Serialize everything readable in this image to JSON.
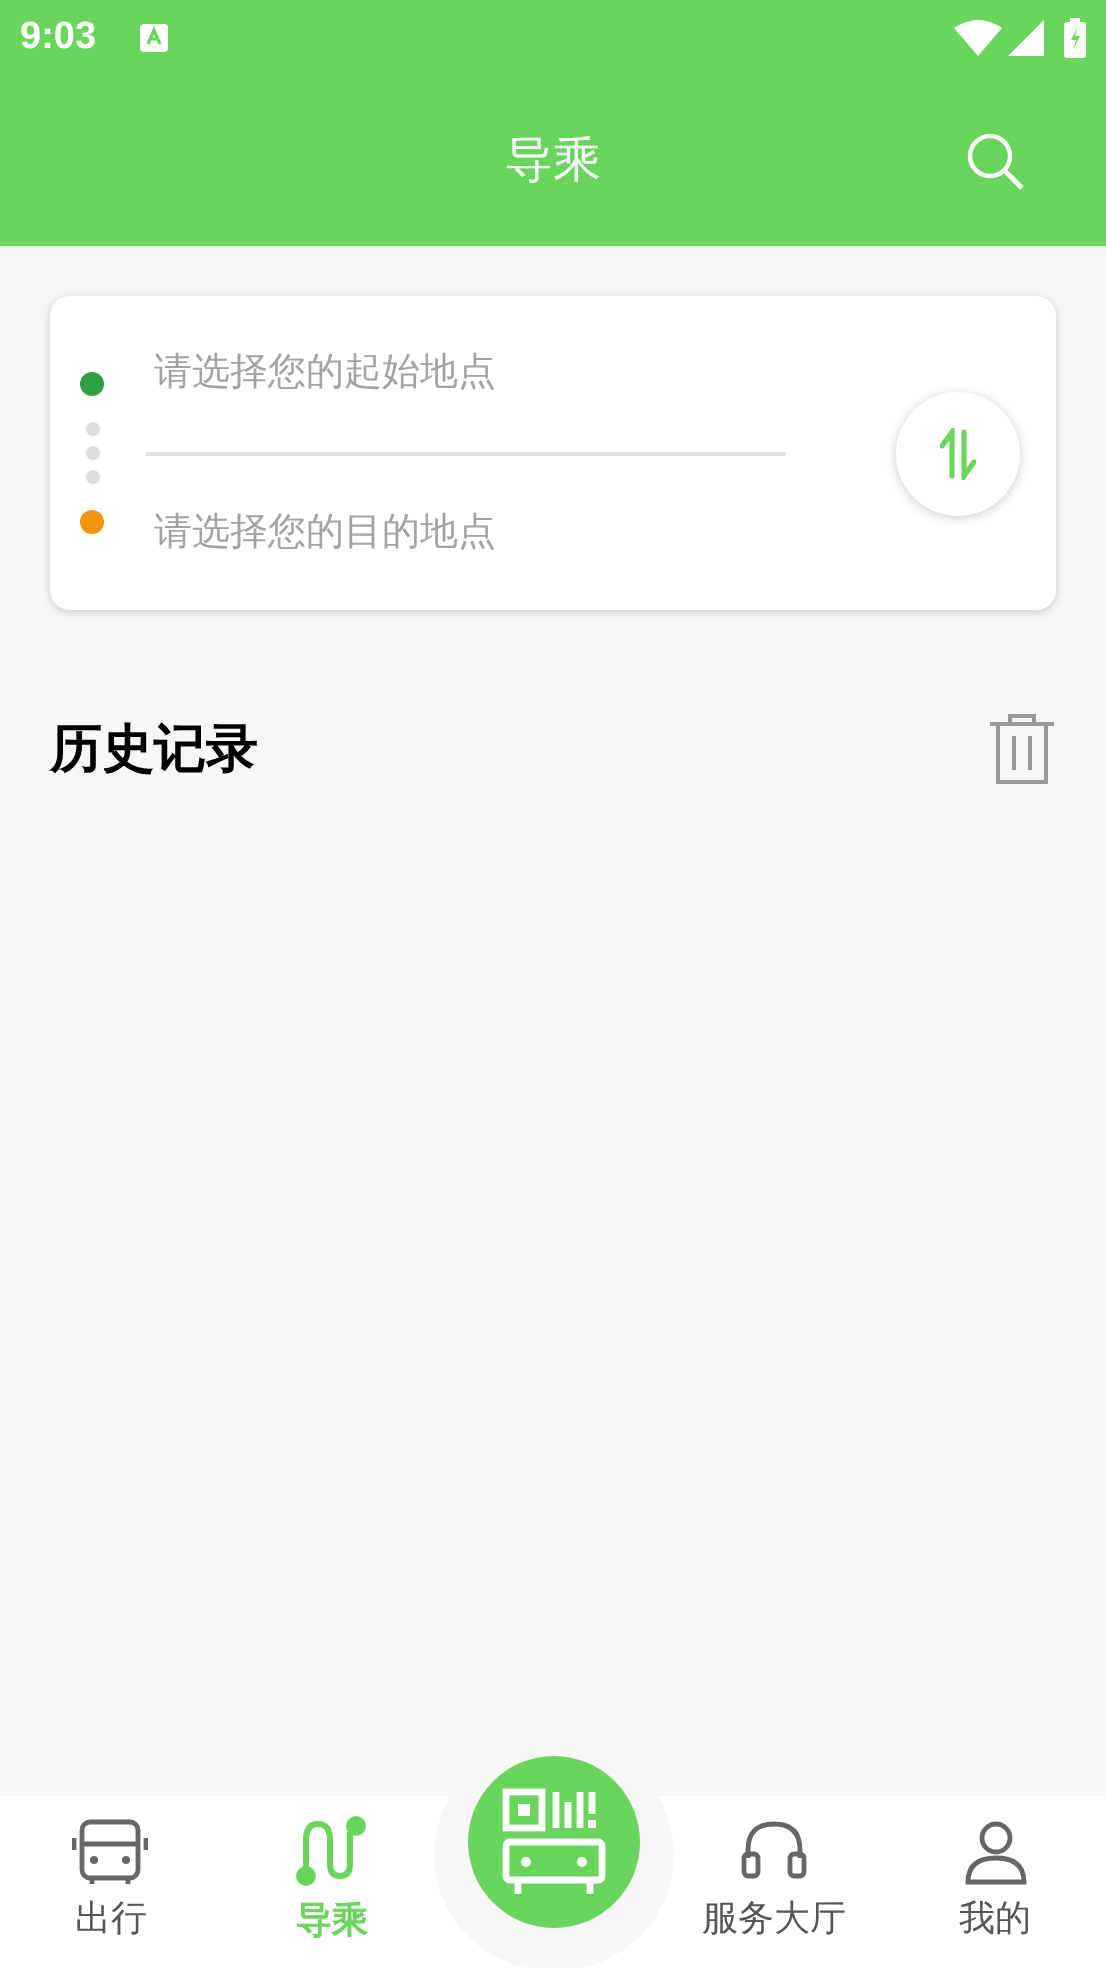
{
  "status_bar": {
    "time": "9:03"
  },
  "app_bar": {
    "title": "导乘"
  },
  "route_card": {
    "origin": {
      "placeholder": "请选择您的起始地点",
      "color": "#2ea043"
    },
    "destination": {
      "placeholder": "请选择您的目的地点",
      "color": "#f5930f"
    }
  },
  "history": {
    "title": "历史记录"
  },
  "bottom_nav": [
    {
      "kind": "bus",
      "label": "出行",
      "selected": false
    },
    {
      "kind": "route",
      "label": "导乘",
      "selected": true
    },
    {
      "kind": "scan"
    },
    {
      "kind": "service",
      "label": "服务大厅",
      "selected": false
    },
    {
      "kind": "user",
      "label": "我的",
      "selected": false
    }
  ]
}
